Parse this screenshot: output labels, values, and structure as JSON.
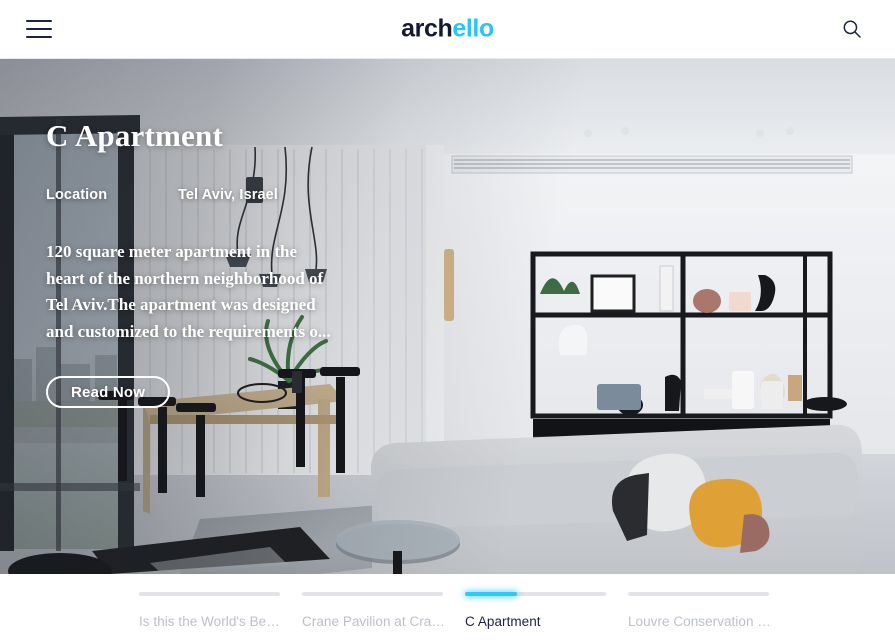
{
  "header": {
    "menu_icon": "hamburger-menu-icon",
    "search_icon": "search-icon",
    "logo": {
      "dark_part": "arch",
      "accent_part": "ello",
      "full": "archello",
      "dark_color": "#141a33",
      "accent_color": "#29c5f6"
    }
  },
  "hero": {
    "title": "C Apartment",
    "meta": {
      "key": "Location",
      "value": "Tel Aviv, Israel"
    },
    "description": "120  square meter apartment in the heart of the northern neighborhood of Tel Aviv.The apartment was designed and customized to the requirements o...",
    "cta_label": "Read Now",
    "image_alt": "Modern apartment interior with light gray sofa, black metal shelving unit, wooden dining table with black chairs, pendant lights and floor-to-ceiling windows"
  },
  "carousel": {
    "active_index": 2,
    "active_progress_percent": 37,
    "accent_color": "#2ec8fb",
    "track_color": "#e2e4e8",
    "items": [
      {
        "label": "Is this the World's Be…",
        "active": false
      },
      {
        "label": "Crane Pavilion at Cra…",
        "active": false
      },
      {
        "label": "C Apartment",
        "active": true
      },
      {
        "label": "Louvre Conservation …",
        "active": false
      }
    ]
  }
}
